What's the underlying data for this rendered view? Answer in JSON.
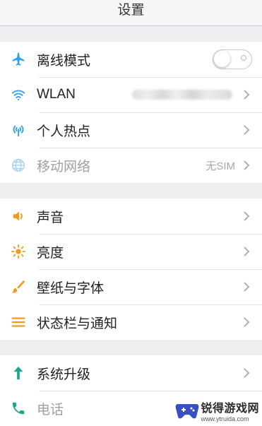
{
  "header": {
    "title": "设置"
  },
  "groups": [
    {
      "items": [
        {
          "label": "离线模式",
          "icon": "airplane-icon",
          "color": "#2aa1e8"
        },
        {
          "label": "WLAN",
          "icon": "wifi-icon",
          "color": "#2aa1e8"
        },
        {
          "label": "个人热点",
          "icon": "hotspot-icon",
          "color": "#2aa1e8"
        },
        {
          "label": "移动网络",
          "icon": "globe-icon",
          "color": "#a8d3ee",
          "value": "无SIM"
        }
      ]
    },
    {
      "items": [
        {
          "label": "声音",
          "icon": "speaker-icon",
          "color": "#f39a1e"
        },
        {
          "label": "亮度",
          "icon": "sun-icon",
          "color": "#f39a1e"
        },
        {
          "label": "壁纸与字体",
          "icon": "brush-icon",
          "color": "#f39a1e"
        },
        {
          "label": "状态栏与通知",
          "icon": "list-icon",
          "color": "#f39a1e"
        }
      ]
    },
    {
      "items": [
        {
          "label": "系统升级",
          "icon": "arrow-up-icon",
          "color": "#1aa68a"
        },
        {
          "label": "电话",
          "icon": "phone-icon",
          "color": "#1aa68a"
        }
      ]
    }
  ],
  "toggles": {
    "offline_mode": false
  },
  "watermark": {
    "main": "锐得游戏网",
    "url": "www.ytruida.com"
  }
}
